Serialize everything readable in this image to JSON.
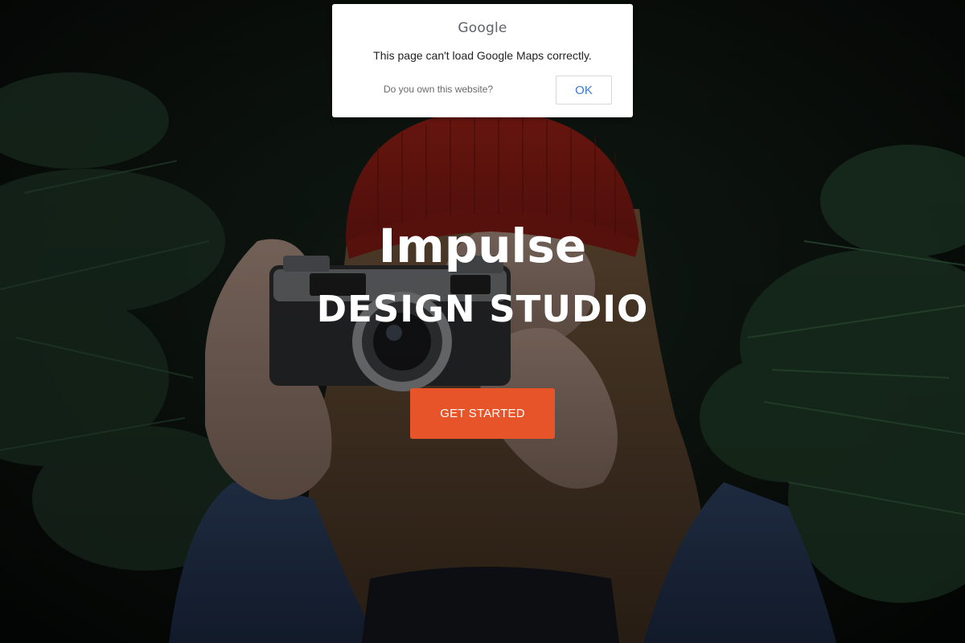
{
  "hero": {
    "background_image": "photographer-with-camera-red-beanie",
    "title": "Impulse",
    "subtitle": "DESIGN STUDIO",
    "cta_label": "GET STARTED"
  },
  "maps_error_dialog": {
    "logo_text": "Google",
    "message": "This page can't load Google Maps correctly.",
    "own_website_link": "Do you own this website?",
    "ok_label": "OK"
  },
  "colors": {
    "accent": "#e8542a",
    "ok_text": "#3a7bd5"
  }
}
